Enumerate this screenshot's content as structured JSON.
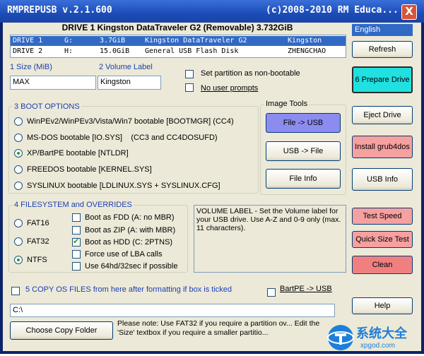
{
  "window": {
    "title": "RMPREPUSB v.2.1.600",
    "title_right": "(c)2008-2010 RM Educa...",
    "close_label": "X"
  },
  "drives": {
    "heading": "DRIVE 1 Kingston DataTraveler G2 (Removable) 3.732GiB",
    "rows": [
      {
        "drive": "DRIVE 1",
        "letter": "G:",
        "size": "3.7GiB",
        "name": "Kingston DataTraveler G2",
        "label": "Kingston"
      },
      {
        "drive": "DRIVE 2",
        "letter": "H:",
        "size": "15.0GiB",
        "name": "General USB Flash Disk",
        "label": "ZHENGCHAO"
      }
    ]
  },
  "language": {
    "selected": "English"
  },
  "buttons": {
    "refresh": "Refresh",
    "prepare_drive": "6 Prepare Drive",
    "eject_drive": "Eject Drive",
    "install_grub": "Install grub4dos",
    "usb_info": "USB Info",
    "test_speed": "Test Speed",
    "quick_size_test": "Quick Size Test",
    "clean": "Clean",
    "help": "Help",
    "file_to_usb": "File -> USB",
    "usb_to_file": "USB -> File",
    "file_info": "File Info",
    "choose_copy_folder": "Choose Copy Folder"
  },
  "size": {
    "label": "1 Size (MiB)",
    "value": "MAX"
  },
  "volume": {
    "label": "2 Volume Label",
    "value": "Kingston"
  },
  "options": {
    "non_bootable": "Set partition as non-bootable",
    "no_prompts": "No user prompts"
  },
  "boot": {
    "title": "3 BOOT OPTIONS",
    "items": [
      "WinPEv2/WinPEv3/Vista/Win7 bootable [BOOTMGR] (CC4)",
      "MS-DOS bootable [IO.SYS]    (CC3 and CC4DOSUFD)",
      "XP/BartPE bootable [NTLDR]",
      "FREEDOS bootable [KERNEL.SYS]",
      "SYSLINUX bootable [LDLINUX.SYS + SYSLINUX.CFG]"
    ]
  },
  "image_tools": {
    "title": "Image Tools"
  },
  "fs": {
    "title": "4 FILESYSTEM and OVERRIDES",
    "types": [
      "FAT16",
      "FAT32",
      "NTFS"
    ],
    "overrides": [
      "Boot as FDD (A: no MBR)",
      "Boot as ZIP (A: with MBR)",
      "Boot as HDD (C: 2PTNS)",
      "Force use of LBA calls",
      "Use 64hd/32sec if possible"
    ]
  },
  "info_text": "VOLUME LABEL - Set the Volume label for your USB drive. Use A-Z and 0-9 only (max. 11 characters).",
  "copy": {
    "label": "5 COPY OS FILES from here after formatting if box is ticked",
    "bartpe": "BartPE -> USB",
    "path": "C:\\"
  },
  "bottom_note": "Please note: Use FAT32 if you require a partition ov... Edit the 'Size' textbox if you require a smaller partitio...",
  "watermark": {
    "text": "系统大全",
    "sub": "xpgod.com"
  },
  "colors": {
    "prepare": "#20e0e0",
    "file_to_usb": "#8c8cf0",
    "pink": "#f6a0a0",
    "clean": "#f08080",
    "title": "#1c4cb8"
  }
}
